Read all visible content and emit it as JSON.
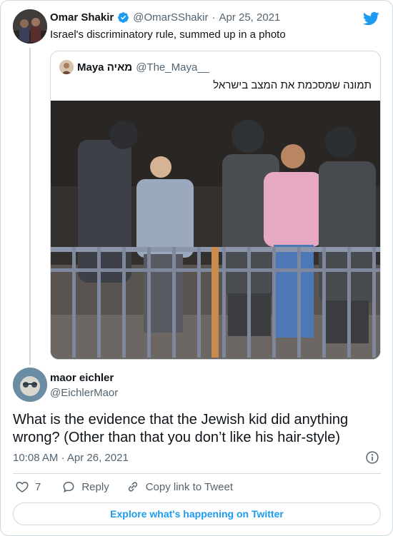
{
  "tweet": {
    "author_name": "Omar Shakir",
    "author_handle": "@OmarSShakir",
    "separator": "·",
    "date": "Apr 25, 2021",
    "text": "Israel's discriminatory rule, summed up in a photo"
  },
  "quoted": {
    "author_name": "Maya מאיה",
    "author_handle": "@The_Maya__",
    "text": "תמונה שמסכמת את המצב בישראל"
  },
  "reply": {
    "author_name": "maor eichler",
    "author_handle": "@EichlerMaor",
    "text": "What is the evidence that the Jewish kid did anything wrong? (Other than that you don’t like his hair-style)",
    "time": "10:08 AM",
    "separator": "·",
    "date": "Apr 26, 2021",
    "like_count": "7",
    "reply_label": "Reply",
    "copy_link_label": "Copy link to Tweet"
  },
  "footer": {
    "explore_label": "Explore what's happening on Twitter"
  },
  "colors": {
    "accent": "#1d9bf0",
    "secondary_text": "#536471",
    "border": "#cfd9de"
  },
  "icons": [
    "twitter-bird-icon",
    "verified-badge-icon",
    "info-icon",
    "heart-icon",
    "reply-bubble-icon",
    "link-icon"
  ]
}
